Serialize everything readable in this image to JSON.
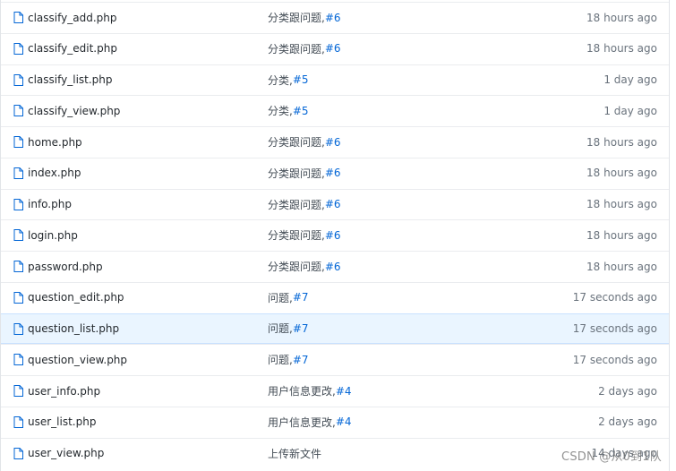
{
  "rows": [
    {
      "file": "classify_add.php",
      "commit_text": "分类跟问题,",
      "commit_ref": "#6",
      "age": "18 hours ago"
    },
    {
      "file": "classify_edit.php",
      "commit_text": "分类跟问题,",
      "commit_ref": "#6",
      "age": "18 hours ago"
    },
    {
      "file": "classify_list.php",
      "commit_text": "分类,",
      "commit_ref": "#5",
      "age": "1 day ago"
    },
    {
      "file": "classify_view.php",
      "commit_text": "分类,",
      "commit_ref": "#5",
      "age": "1 day ago"
    },
    {
      "file": "home.php",
      "commit_text": "分类跟问题,",
      "commit_ref": "#6",
      "age": "18 hours ago"
    },
    {
      "file": "index.php",
      "commit_text": "分类跟问题,",
      "commit_ref": "#6",
      "age": "18 hours ago"
    },
    {
      "file": "info.php",
      "commit_text": "分类跟问题,",
      "commit_ref": "#6",
      "age": "18 hours ago"
    },
    {
      "file": "login.php",
      "commit_text": "分类跟问题,",
      "commit_ref": "#6",
      "age": "18 hours ago"
    },
    {
      "file": "password.php",
      "commit_text": "分类跟问题,",
      "commit_ref": "#6",
      "age": "18 hours ago"
    },
    {
      "file": "question_edit.php",
      "commit_text": "问题,",
      "commit_ref": "#7",
      "age": "17 seconds ago"
    },
    {
      "file": "question_list.php",
      "commit_text": "问题,",
      "commit_ref": "#7",
      "age": "17 seconds ago"
    },
    {
      "file": "question_view.php",
      "commit_text": "问题,",
      "commit_ref": "#7",
      "age": "17 seconds ago"
    },
    {
      "file": "user_info.php",
      "commit_text": "用户信息更改,",
      "commit_ref": "#4",
      "age": "2 days ago"
    },
    {
      "file": "user_list.php",
      "commit_text": "用户信息更改,",
      "commit_ref": "#4",
      "age": "2 days ago"
    },
    {
      "file": "user_view.php",
      "commit_text": "上传新文件",
      "commit_ref": "",
      "age": "14 days ago"
    }
  ],
  "highlighted_row": 10,
  "watermark": "CSDN @从0到1队",
  "colors": {
    "link": "#0366d6",
    "icon": "#6a737d",
    "highlight_bg": "#eaf5ff"
  },
  "icons": {
    "file": "file-icon"
  }
}
